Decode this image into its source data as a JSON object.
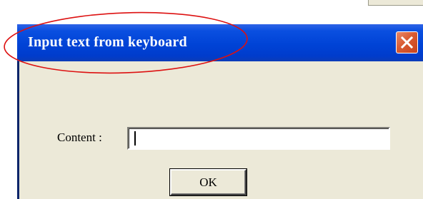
{
  "dialog": {
    "title": "Input text from keyboard",
    "close_icon": "close-icon",
    "content_label": "Content :",
    "content_value": "",
    "ok_label": "OK"
  },
  "colors": {
    "title_bar": "#0043d6",
    "dialog_background": "#ece9d8",
    "close_button": "#d95b32",
    "annotation_ellipse": "#dd1111"
  }
}
